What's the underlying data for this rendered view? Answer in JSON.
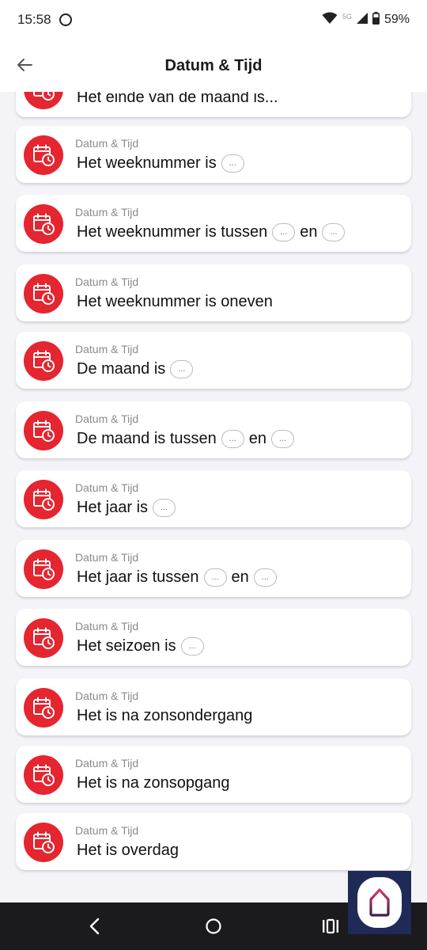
{
  "status_bar": {
    "time": "15:58",
    "network": "5G",
    "battery": "59%"
  },
  "app_bar": {
    "title": "Datum & Tijd"
  },
  "colors": {
    "accent": "#e5252f",
    "background": "#f3f3f8",
    "nav_bar": "#1b1b1d",
    "fab_bg": "#1f2a57"
  },
  "icons": {
    "back": "arrow-left-icon",
    "item": "calendar-clock-icon",
    "nav_back": "chevron-left-icon",
    "nav_home": "circle-home-icon",
    "nav_recents": "recents-icon",
    "fab": "house-icon"
  },
  "pill_label": "...",
  "items": [
    {
      "category": "",
      "segments": [
        {
          "t": "Het einde van de maand is..."
        }
      ]
    },
    {
      "category": "Datum & Tijd",
      "segments": [
        {
          "t": "Het weeknummer is"
        },
        {
          "p": 1
        }
      ]
    },
    {
      "category": "Datum & Tijd",
      "segments": [
        {
          "t": "Het weeknummer is tussen"
        },
        {
          "p": 1
        },
        {
          "t": "en"
        },
        {
          "p": 1
        }
      ]
    },
    {
      "category": "Datum & Tijd",
      "segments": [
        {
          "t": "Het weeknummer is oneven"
        }
      ]
    },
    {
      "category": "Datum & Tijd",
      "segments": [
        {
          "t": "De maand is"
        },
        {
          "p": 1
        }
      ]
    },
    {
      "category": "Datum & Tijd",
      "segments": [
        {
          "t": "De maand is tussen"
        },
        {
          "p": 1
        },
        {
          "t": "en"
        },
        {
          "p": 1
        }
      ]
    },
    {
      "category": "Datum & Tijd",
      "segments": [
        {
          "t": "Het jaar is"
        },
        {
          "p": 1
        }
      ]
    },
    {
      "category": "Datum & Tijd",
      "segments": [
        {
          "t": "Het jaar is tussen"
        },
        {
          "p": 1
        },
        {
          "t": "en"
        },
        {
          "p": 1
        }
      ]
    },
    {
      "category": "Datum & Tijd",
      "segments": [
        {
          "t": "Het seizoen is"
        },
        {
          "p": 1
        }
      ]
    },
    {
      "category": "Datum & Tijd",
      "segments": [
        {
          "t": "Het is na zonsondergang"
        }
      ]
    },
    {
      "category": "Datum & Tijd",
      "segments": [
        {
          "t": "Het is na zonsopgang"
        }
      ]
    },
    {
      "category": "Datum & Tijd",
      "segments": [
        {
          "t": "Het is overdag"
        }
      ]
    }
  ]
}
